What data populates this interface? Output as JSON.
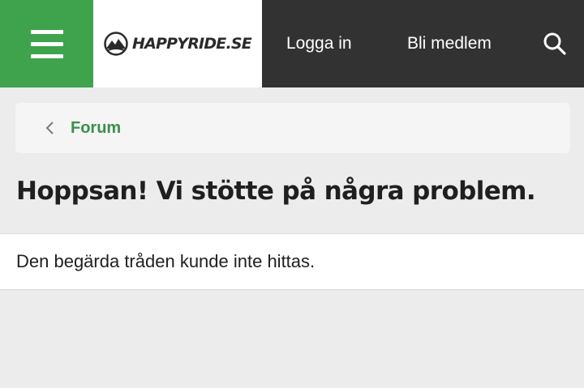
{
  "header": {
    "logo_text": "HAPPYRIDE.SE",
    "login_label": "Logga in",
    "join_label": "Bli medlem",
    "icons": {
      "menu": "hamburger-menu-icon",
      "logo": "mountain-logo-icon",
      "search": "search-icon"
    }
  },
  "breadcrumb": {
    "label": "Forum",
    "icon": "chevron-left-icon"
  },
  "page": {
    "title": "Hoppsan! Vi stötte på några problem.",
    "message": "Den begärda tråden kunde inte hittas."
  },
  "colors": {
    "header_bg": "#323232",
    "menu_green": "#3fa34d",
    "link_green": "#3a8f4a",
    "page_bg": "#ececec"
  }
}
